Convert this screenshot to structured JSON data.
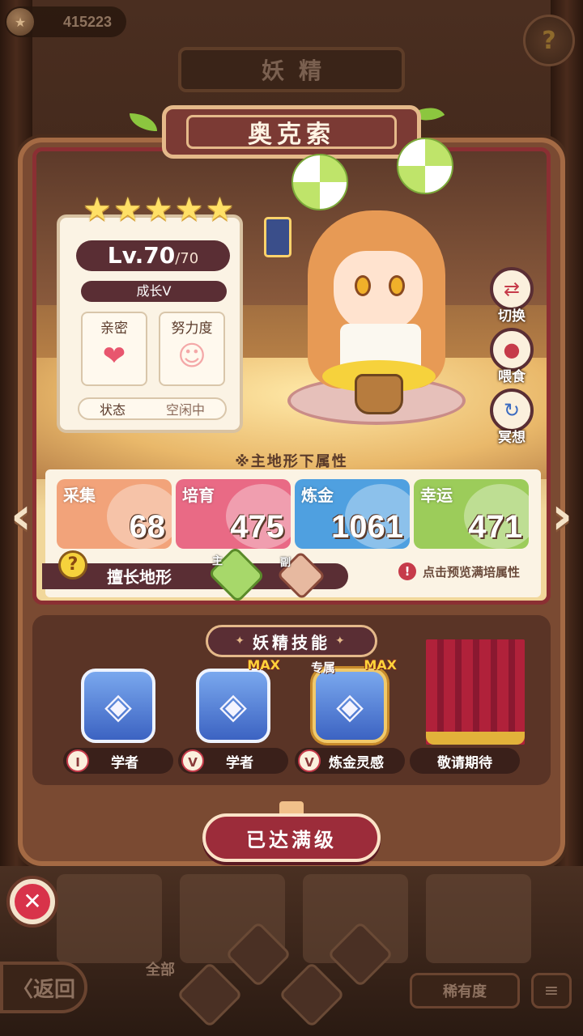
{
  "header": {
    "currency_value": "415223",
    "page_title": "妖精",
    "help_symbol": "?"
  },
  "fairy": {
    "name": "奥克索",
    "stars": 5,
    "level": "Lv.70",
    "level_max": "/70",
    "growth": "成长V",
    "intimacy_label": "亲密",
    "effort_label": "努力度",
    "status_label": "状态",
    "status_value": "空闲中"
  },
  "side_actions": [
    {
      "label": "切换",
      "icon": "switch-icon"
    },
    {
      "label": "喂食",
      "icon": "meat-icon"
    },
    {
      "label": "冥想",
      "icon": "meditate-icon"
    }
  ],
  "attributes": {
    "title": "※主地形下属性",
    "items": [
      {
        "name": "采集",
        "value": "68",
        "color": "#f2a37a"
      },
      {
        "name": "培育",
        "value": "475",
        "color": "#e96a85"
      },
      {
        "name": "炼金",
        "value": "1061",
        "color": "#4fa0e0"
      },
      {
        "name": "幸运",
        "value": "471",
        "color": "#9ccc5a"
      }
    ],
    "terrain_label": "擅长地形",
    "terrain_main_tag": "主",
    "terrain_sub_tag": "副",
    "preview_text": "点击预览满培属性"
  },
  "skills": {
    "title": "妖精技能",
    "items": [
      {
        "rank": "I",
        "name": "学者",
        "max": "",
        "exclusive": ""
      },
      {
        "rank": "V",
        "name": "学者",
        "max": "MAX",
        "exclusive": ""
      },
      {
        "rank": "V",
        "name": "炼金灵感",
        "max": "MAX",
        "exclusive": "专属"
      },
      {
        "rank": "",
        "name": "敬请期待",
        "max": "",
        "exclusive": ""
      }
    ]
  },
  "max_button": "已达满级",
  "bottom": {
    "back_label": "〈返回",
    "filter_all": "全部",
    "rarity_label": "稀有度",
    "sort_icon": "sort-icon"
  }
}
